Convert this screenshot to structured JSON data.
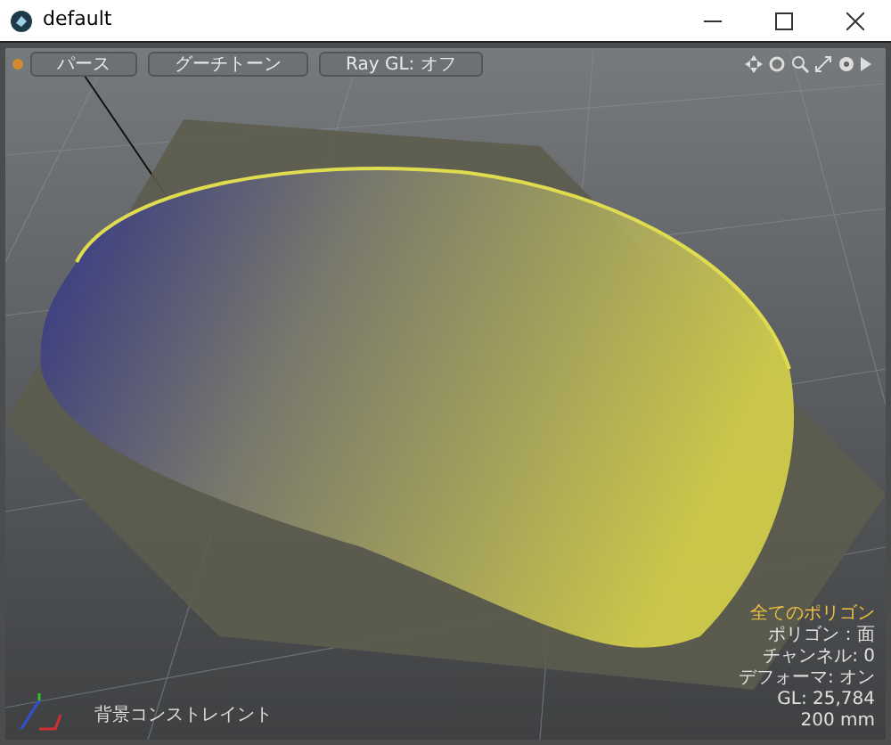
{
  "window": {
    "title": "default"
  },
  "viewport": {
    "tabs": [
      {
        "label": "パース"
      },
      {
        "label": "グーチトーン"
      },
      {
        "label": "Ray GL: オフ"
      }
    ],
    "status_text": "背景コンストレイント",
    "info": [
      {
        "text": "全てのポリゴン",
        "kind": "heading"
      },
      {
        "text": "ポリゴン：面",
        "kind": "line"
      },
      {
        "text": "チャンネル: 0",
        "kind": "line"
      },
      {
        "text": "デフォーマ: オン",
        "kind": "line"
      },
      {
        "text": "GL: 25,784",
        "kind": "line"
      },
      {
        "text": "200 mm",
        "kind": "line"
      }
    ]
  }
}
